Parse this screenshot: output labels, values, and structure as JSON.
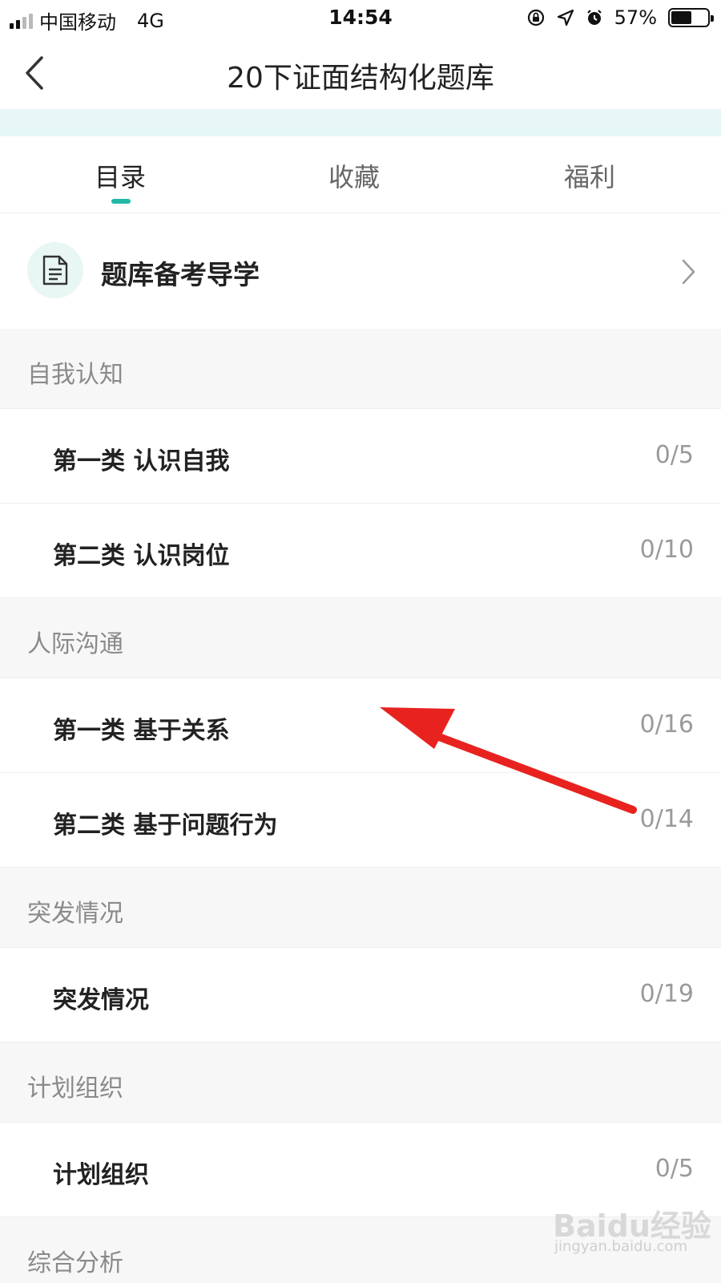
{
  "status_bar": {
    "carrier": "中国移动",
    "network": "4G",
    "time": "14:54",
    "battery": "57%",
    "battery_level": 0.57
  },
  "nav": {
    "title": "20下证面结构化题库"
  },
  "tabs": [
    {
      "label": "目录",
      "active": true
    },
    {
      "label": "收藏",
      "active": false
    },
    {
      "label": "福利",
      "active": false
    }
  ],
  "guide": {
    "label": "题库备考导学",
    "icon": "document-icon"
  },
  "sections": [
    {
      "title": "自我认知",
      "items": [
        {
          "label": "第一类 认识自我",
          "count": "0/5"
        },
        {
          "label": "第二类 认识岗位",
          "count": "0/10"
        }
      ]
    },
    {
      "title": "人际沟通",
      "items": [
        {
          "label": "第一类 基于关系",
          "count": "0/16"
        },
        {
          "label": "第二类 基于问题行为",
          "count": "0/14"
        }
      ]
    },
    {
      "title": "突发情况",
      "items": [
        {
          "label": "突发情况",
          "count": "0/19"
        }
      ]
    },
    {
      "title": "计划组织",
      "items": [
        {
          "label": "计划组织",
          "count": "0/5"
        }
      ]
    },
    {
      "title": "综合分析",
      "items": []
    }
  ],
  "watermark": {
    "main": "Baidu经验",
    "sub": "jingyan.baidu.com"
  },
  "colors": {
    "accent": "#22b9a5",
    "teal_band": "#e6f7f5",
    "annotation_arrow": "#e8231f"
  }
}
